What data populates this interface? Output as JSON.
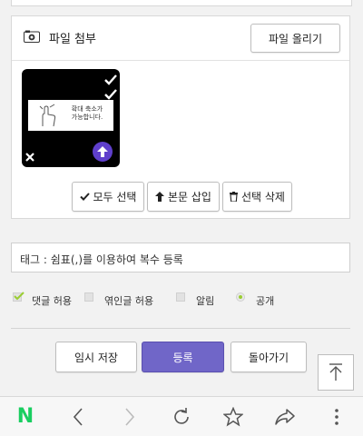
{
  "attachment": {
    "title": "파일 첨부",
    "upload_button": "파일 올리기",
    "thumb_text": "확대 축소가\n가능합니다.",
    "select_all": "모두 선택",
    "insert_body": "본문 삽입",
    "delete_selected": "선택 삭제"
  },
  "tag": {
    "placeholder": "태그 : 쉼표(,)를 이용하여 복수 등록"
  },
  "options": {
    "comments": {
      "label": "댓글 허용",
      "checked": true
    },
    "trackback": {
      "label": "엮인글 허용",
      "checked": false
    },
    "notify": {
      "label": "알림",
      "checked": false
    },
    "public": {
      "label": "공개",
      "selected": true
    }
  },
  "actions": {
    "draft": "임시 저장",
    "submit": "등록",
    "back": "돌아가기"
  },
  "colors": {
    "accent": "#7066c8",
    "naver_green": "#19ce60",
    "upload_circle": "#5f3fcc"
  },
  "navbar": {
    "icons": [
      "naver-logo-icon",
      "back-icon",
      "forward-icon",
      "reload-icon",
      "bookmark-star-icon",
      "share-icon",
      "more-icon"
    ],
    "logo_text": "N"
  }
}
